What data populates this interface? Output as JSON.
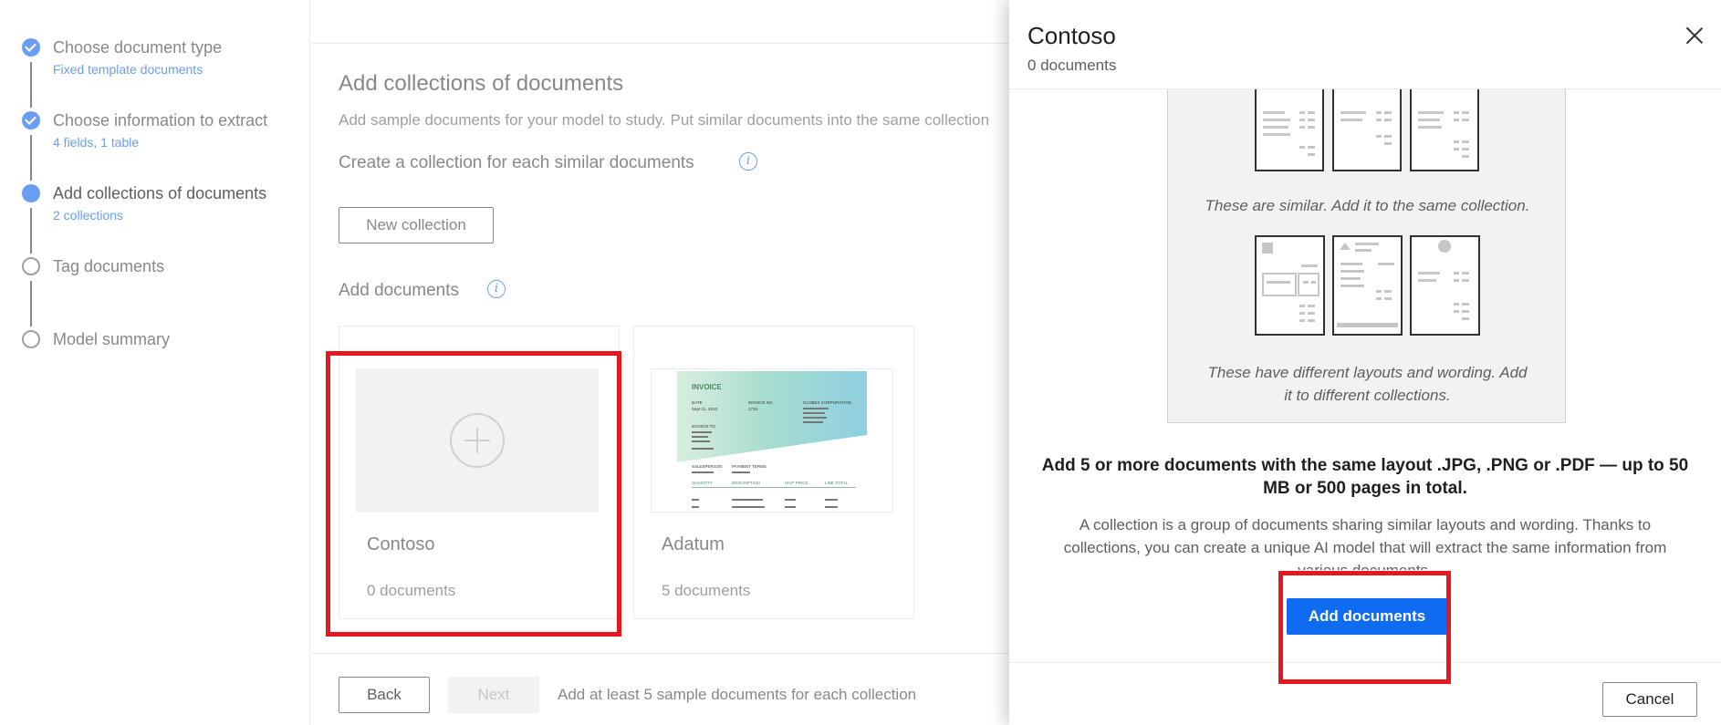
{
  "stepper": {
    "steps": [
      {
        "title": "Choose document type",
        "sub": "Fixed template documents",
        "state": "done"
      },
      {
        "title": "Choose information to extract",
        "sub": "4 fields, 1 table",
        "state": "done"
      },
      {
        "title": "Add collections of documents",
        "sub": "2 collections",
        "state": "current"
      },
      {
        "title": "Tag documents",
        "sub": "",
        "state": "todo"
      },
      {
        "title": "Model summary",
        "sub": "",
        "state": "todo"
      }
    ]
  },
  "main": {
    "title": "Add collections of documents",
    "description": "Add sample documents for your model to study. Put similar documents into the same collection",
    "create_heading": "Create a collection for each similar documents",
    "new_collection_label": "New collection",
    "add_documents_heading": "Add documents",
    "cards": [
      {
        "name": "Contoso",
        "count": "0 documents"
      },
      {
        "name": "Adatum",
        "count": "5 documents"
      }
    ],
    "invoice_preview": {
      "heading": "INVOICE",
      "date_label": "DATE",
      "date_value": "Sept 21, 2013",
      "invoice_no_label": "INVOICE NO",
      "invoice_no_value": "1733",
      "company": "GLOBEX CORPORATION",
      "invoice_to_label": "INVOICE TO",
      "salesperson_label": "SALESPERSON",
      "payment_terms_label": "PAYMENT TERMS",
      "col_quantity": "QUANTITY",
      "col_description": "DESCRIPTION",
      "col_unit_price": "UNIT PRICE",
      "col_line_total": "LINE TOTAL"
    },
    "footer": {
      "back_label": "Back",
      "next_label": "Next",
      "note": "Add at least 5 sample documents for each collection"
    }
  },
  "panel": {
    "title": "Contoso",
    "subtitle": "0 documents",
    "caption_similar": "These are similar. Add it to the same collection.",
    "caption_different": "These have different layouts and wording. Add it to different collections.",
    "requirements": "Add 5 or more documents with the same layout .JPG, .PNG or .PDF — up to 50 MB or 500 pages in total.",
    "body": "A collection is a group of documents sharing similar layouts and wording. Thanks to collections, you can create a unique AI model that will extract the same information from various documents.",
    "add_documents_label": "Add documents",
    "cancel_label": "Cancel"
  },
  "colors": {
    "accent": "#0f6cf2",
    "step_accent": "#6a9ef0",
    "highlight_box": "#e5191c"
  }
}
